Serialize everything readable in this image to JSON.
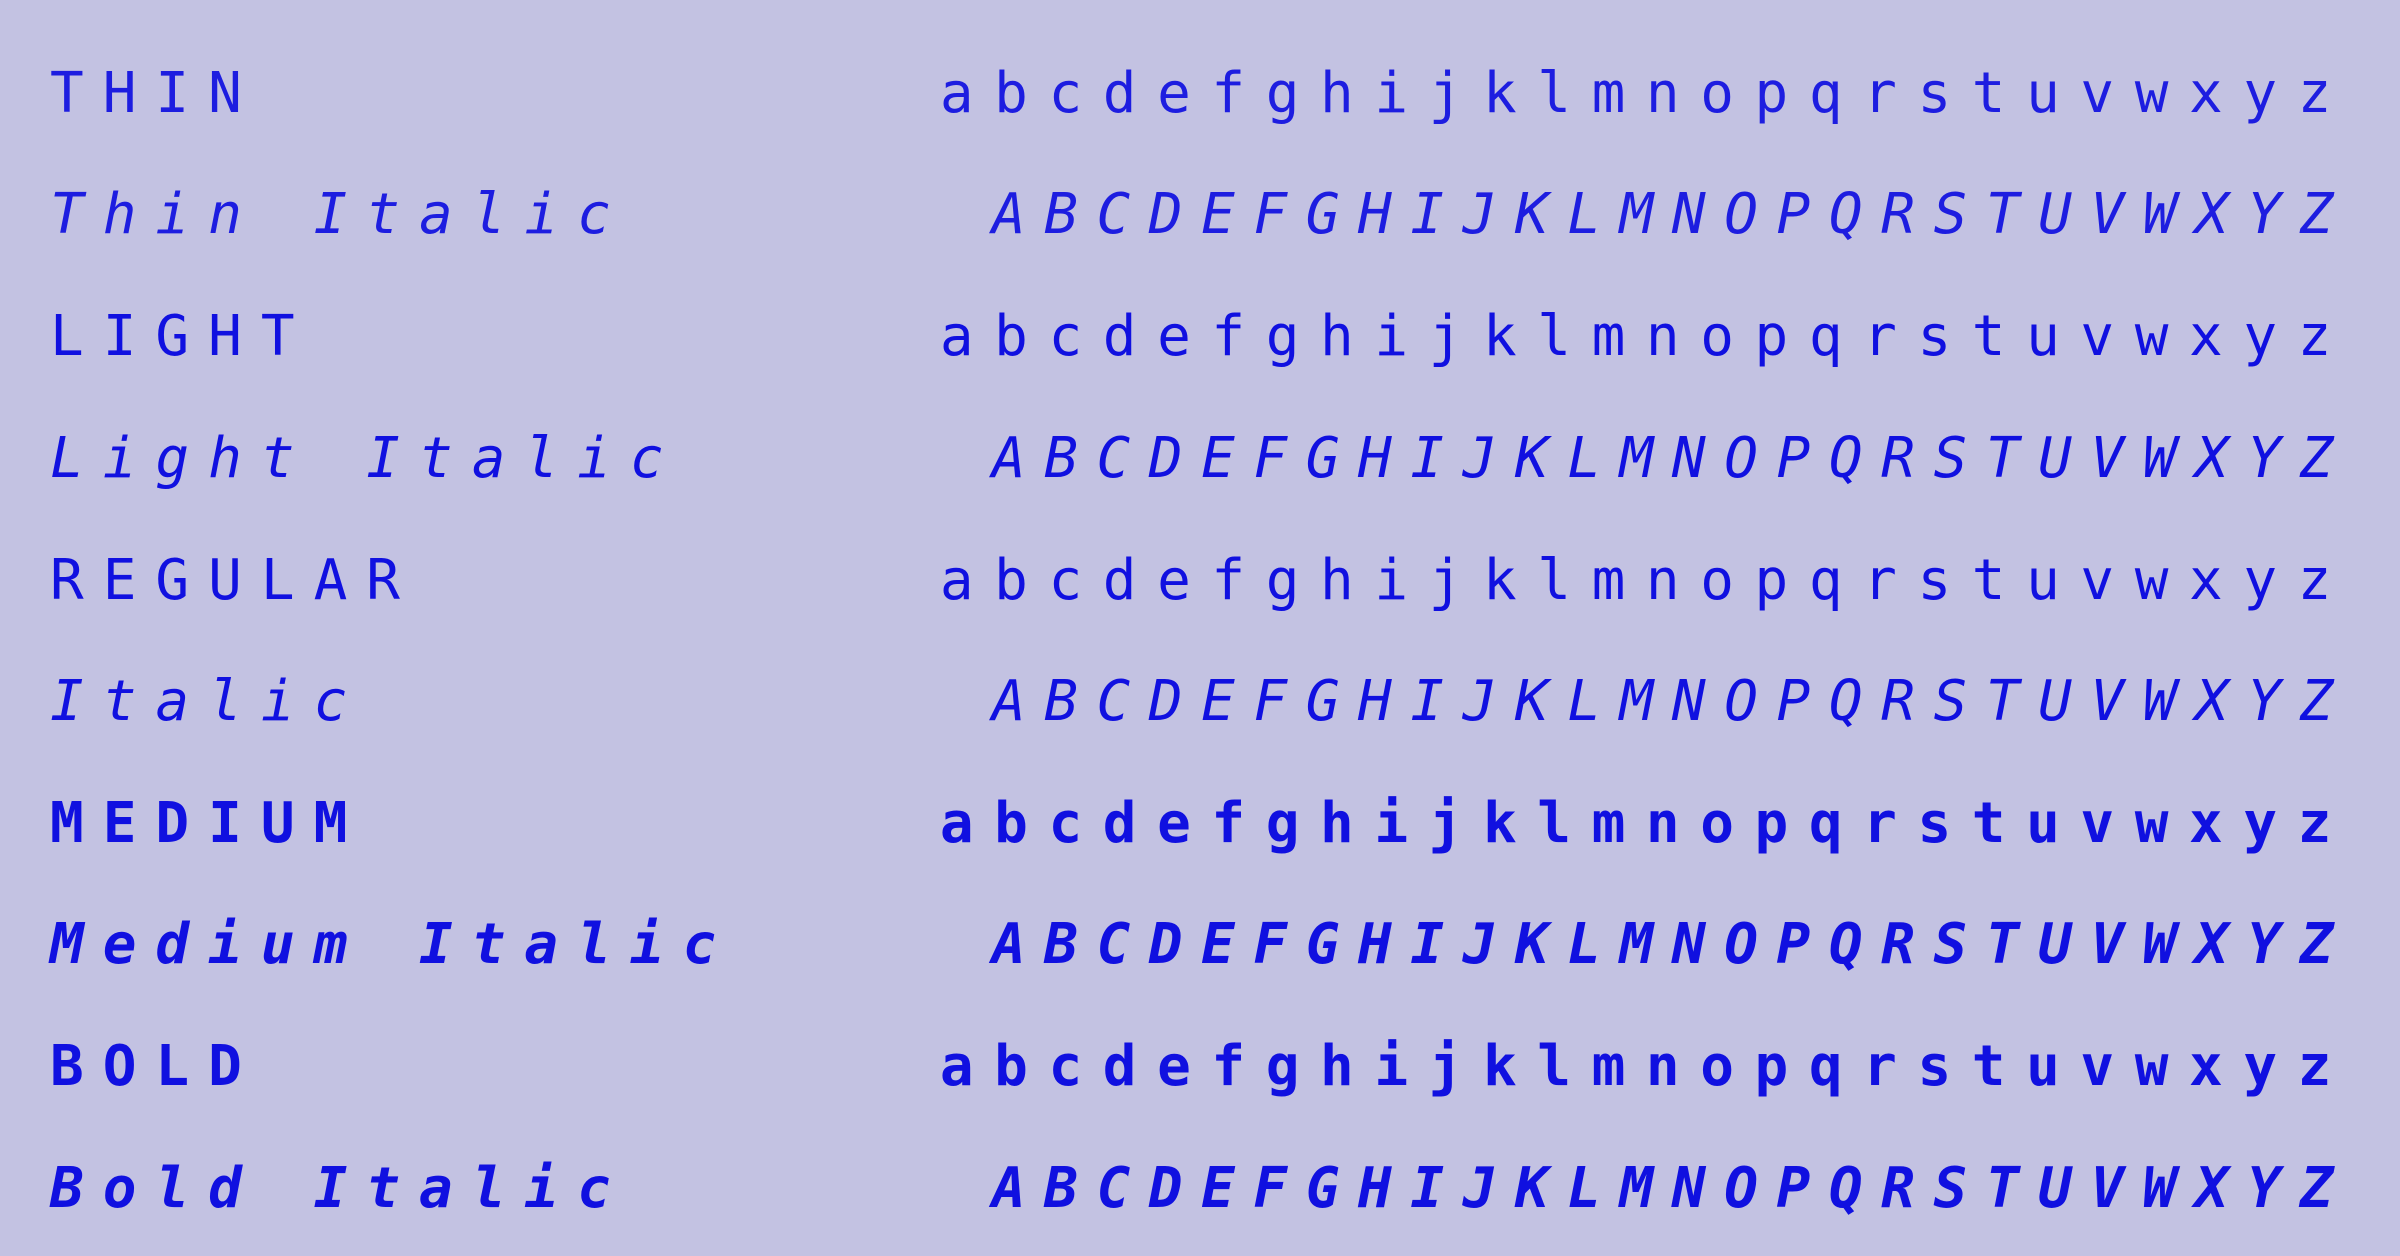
{
  "colors": {
    "background": "#c3c2e2",
    "text": "#1010e0"
  },
  "rows": [
    {
      "label": "THIN",
      "glyphs": "abcdefghijklmnopqrstuvwxyz"
    },
    {
      "label": "Thin Italic",
      "glyphs": "ABCDEFGHIJKLMNOPQRSTUVWXYZ"
    },
    {
      "label": "LIGHT",
      "glyphs": "abcdefghijklmnopqrstuvwxyz"
    },
    {
      "label": "Light Italic",
      "glyphs": "ABCDEFGHIJKLMNOPQRSTUVWXYZ"
    },
    {
      "label": "REGULAR",
      "glyphs": "abcdefghijklmnopqrstuvwxyz"
    },
    {
      "label": "Italic",
      "glyphs": "ABCDEFGHIJKLMNOPQRSTUVWXYZ"
    },
    {
      "label": "MEDIUM",
      "glyphs": "abcdefghijklmnopqrstuvwxyz"
    },
    {
      "label": "Medium Italic",
      "glyphs": "ABCDEFGHIJKLMNOPQRSTUVWXYZ"
    },
    {
      "label": "BOLD",
      "glyphs": "abcdefghijklmnopqrstuvwxyz"
    },
    {
      "label": "Bold Italic",
      "glyphs": "ABCDEFGHIJKLMNOPQRSTUVWXYZ"
    }
  ]
}
